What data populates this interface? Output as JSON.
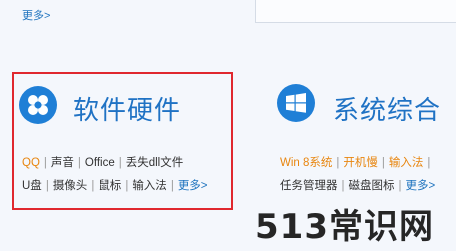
{
  "top": {
    "more_label": "更多>"
  },
  "panels": [
    {
      "icon": "hardware-flower-icon",
      "title": "软件硬件",
      "row1": [
        "QQ",
        "声音",
        "Office",
        "丢失dll文件"
      ],
      "row2": [
        "U盘",
        "摄像头",
        "鼠标",
        "输入法"
      ],
      "more_label": "更多>"
    },
    {
      "icon": "windows-logo-icon",
      "title": "系统综合",
      "row1": [
        "Win 8系统",
        "开机慢",
        "输入法"
      ],
      "row2": [
        "任务管理器",
        "磁盘图标"
      ],
      "more_label": "更多>"
    }
  ],
  "watermark": "513常识网",
  "colors": {
    "accent_blue": "#1f7fd6",
    "link_orange": "#e8860f",
    "highlight_red": "#e0282e"
  }
}
